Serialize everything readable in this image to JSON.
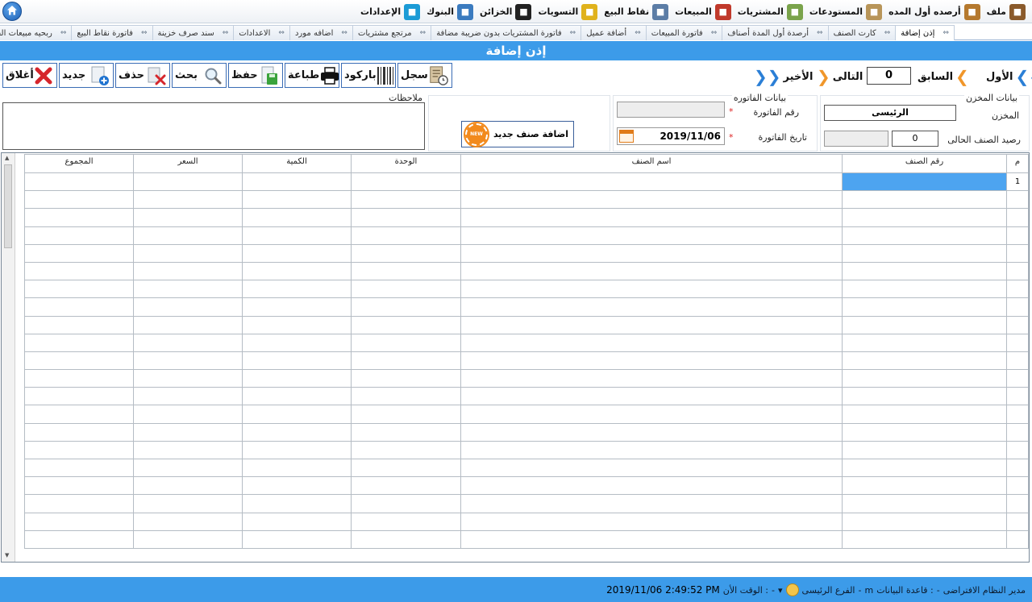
{
  "menu": {
    "items": [
      {
        "label": "ملف",
        "icon": "file-menu-icon",
        "color": "#8a5a2b"
      },
      {
        "label": "أرصده أول المده",
        "icon": "opening-balance-icon",
        "color": "#b5792e"
      },
      {
        "label": "المستودعات",
        "icon": "warehouse-icon",
        "color": "#b89559"
      },
      {
        "label": "المشتريات",
        "icon": "purchases-icon",
        "color": "#7aa34b"
      },
      {
        "label": "المبيعات",
        "icon": "sales-cart-icon",
        "color": "#c0392b"
      },
      {
        "label": "نقاط البيع",
        "icon": "pos-icon",
        "color": "#5c7da6"
      },
      {
        "label": "التسويات",
        "icon": "adjustments-icon",
        "color": "#e0b21c"
      },
      {
        "label": "الخزائن",
        "icon": "safe-icon",
        "color": "#222222"
      },
      {
        "label": "البنوك",
        "icon": "bank-icon",
        "color": "#3b7bbf"
      },
      {
        "label": "الإعدادات",
        "icon": "settings-tools-icon",
        "color": "#1b9bd6"
      }
    ]
  },
  "tabs": [
    {
      "label": "إذن إضافة",
      "active": true
    },
    {
      "label": "كارت الصنف",
      "active": false
    },
    {
      "label": "أرصدة أول المدة أصناف",
      "active": false
    },
    {
      "label": "فاتورة المبيعات",
      "active": false
    },
    {
      "label": "أضافة عميل",
      "active": false
    },
    {
      "label": "فاتورة المشتريات بدون ضريبة مضافة",
      "active": false
    },
    {
      "label": "مرتجع مشتريات",
      "active": false
    },
    {
      "label": "اضافه مورد",
      "active": false
    },
    {
      "label": "الاعدادات",
      "active": false
    },
    {
      "label": "سند صرف خزينة",
      "active": false
    },
    {
      "label": "فاتورة نقاط البيع",
      "active": false
    },
    {
      "label": "ربحيه مبيعات الفرع",
      "active": false
    }
  ],
  "page_title": "إذن إضافة",
  "toolbar": {
    "close": "أغلاق",
    "new": "جديد",
    "delete": "حذف",
    "search": "بحث",
    "save": "حفظ",
    "print": "طباعة",
    "barcode": "باركود",
    "log": "سجل"
  },
  "nav": {
    "first": "الأول",
    "prev": "السابق",
    "counter": "0",
    "next": "التالى",
    "last": "الأخير"
  },
  "notes": {
    "label": "ملاحظات",
    "value": ""
  },
  "new_item": {
    "label": "اضافة صنف جديد",
    "badge": "NEW"
  },
  "invoice": {
    "title": "بيانات الفاتوره",
    "number_label": "رقم الفاتورة",
    "number_value": "",
    "date_label": "تاريخ الفاتورة",
    "date_value": "2019/11/06",
    "required_mark": "*"
  },
  "store": {
    "title": "بيانات المخزن",
    "store_label": "المخزن",
    "store_value": "الرئيسى",
    "balance_label": "رصيد الصنف الحالى",
    "balance_value": "0"
  },
  "grid": {
    "columns": [
      "م",
      "رقم الصنف",
      "اسم الصنف",
      "الوحدة",
      "الكمية",
      "السعر",
      "المجموع"
    ],
    "rows": [
      [
        "1",
        "",
        "",
        "",
        "",
        "",
        ""
      ],
      [
        "",
        "",
        "",
        "",
        "",
        "",
        ""
      ],
      [
        "",
        "",
        "",
        "",
        "",
        "",
        ""
      ],
      [
        "",
        "",
        "",
        "",
        "",
        "",
        ""
      ],
      [
        "",
        "",
        "",
        "",
        "",
        "",
        ""
      ],
      [
        "",
        "",
        "",
        "",
        "",
        "",
        ""
      ],
      [
        "",
        "",
        "",
        "",
        "",
        "",
        ""
      ],
      [
        "",
        "",
        "",
        "",
        "",
        "",
        ""
      ],
      [
        "",
        "",
        "",
        "",
        "",
        "",
        ""
      ],
      [
        "",
        "",
        "",
        "",
        "",
        "",
        ""
      ],
      [
        "",
        "",
        "",
        "",
        "",
        "",
        ""
      ],
      [
        "",
        "",
        "",
        "",
        "",
        "",
        ""
      ],
      [
        "",
        "",
        "",
        "",
        "",
        "",
        ""
      ],
      [
        "",
        "",
        "",
        "",
        "",
        "",
        ""
      ],
      [
        "",
        "",
        "",
        "",
        "",
        "",
        ""
      ],
      [
        "",
        "",
        "",
        "",
        "",
        "",
        ""
      ],
      [
        "",
        "",
        "",
        "",
        "",
        "",
        ""
      ],
      [
        "",
        "",
        "",
        "",
        "",
        "",
        ""
      ],
      [
        "",
        "",
        "",
        "",
        "",
        "",
        ""
      ],
      [
        "",
        "",
        "",
        "",
        "",
        "",
        ""
      ],
      [
        "",
        "",
        "",
        "",
        "",
        "",
        ""
      ]
    ]
  },
  "status": {
    "user": "مدير النظام الافتراضى",
    "sep1": "-",
    "db_label": "قاعدة البيانات :",
    "db_value": "m",
    "sep2": "-",
    "branch": "الفرع الرئيسى",
    "sep3": "-",
    "time_label": "الوقت الأن :",
    "time_value": "2019/11/06 2:49:52 PM"
  },
  "colors": {
    "accent": "#3c9be9",
    "selection": "#4da4f0",
    "nav_arrow": "#f0962a",
    "nav_arrow_blue": "#2b7fd6"
  }
}
